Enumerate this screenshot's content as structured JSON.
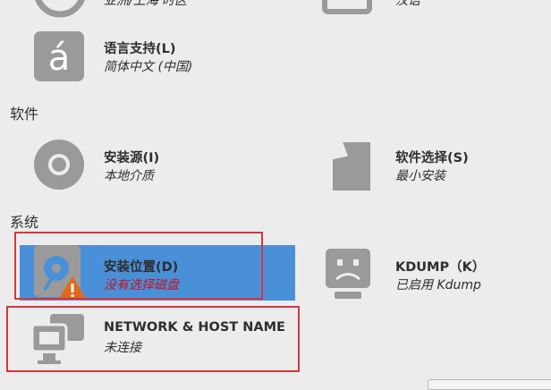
{
  "localization": {
    "time": {
      "title": "",
      "status": "亚洲/上海 时区"
    },
    "keyboard": {
      "title": "",
      "status": "汉语"
    },
    "language": {
      "title": "语言支持(L)",
      "status": "简体中文 (中国)"
    }
  },
  "software": {
    "section_title": "软件",
    "install_source": {
      "title": "安装源(I)",
      "status": "本地介质"
    },
    "software_selection": {
      "title": "软件选择(S)",
      "status": "最小安装"
    }
  },
  "system": {
    "section_title": "系统",
    "install_destination": {
      "title": "安装位置(D)",
      "status": "没有选择磁盘"
    },
    "kdump": {
      "title": "KDUMP（K）",
      "status": "已启用 Kdump"
    },
    "network": {
      "title": "NETWORK & HOST NAME",
      "status": "未连接"
    }
  },
  "colors": {
    "selected": "#4a90d9",
    "highlight_frame": "#d9343f",
    "warning_text": "#c4141b",
    "warning_icon": "#e06a1b",
    "icon_gray": "#9a9a9a"
  }
}
